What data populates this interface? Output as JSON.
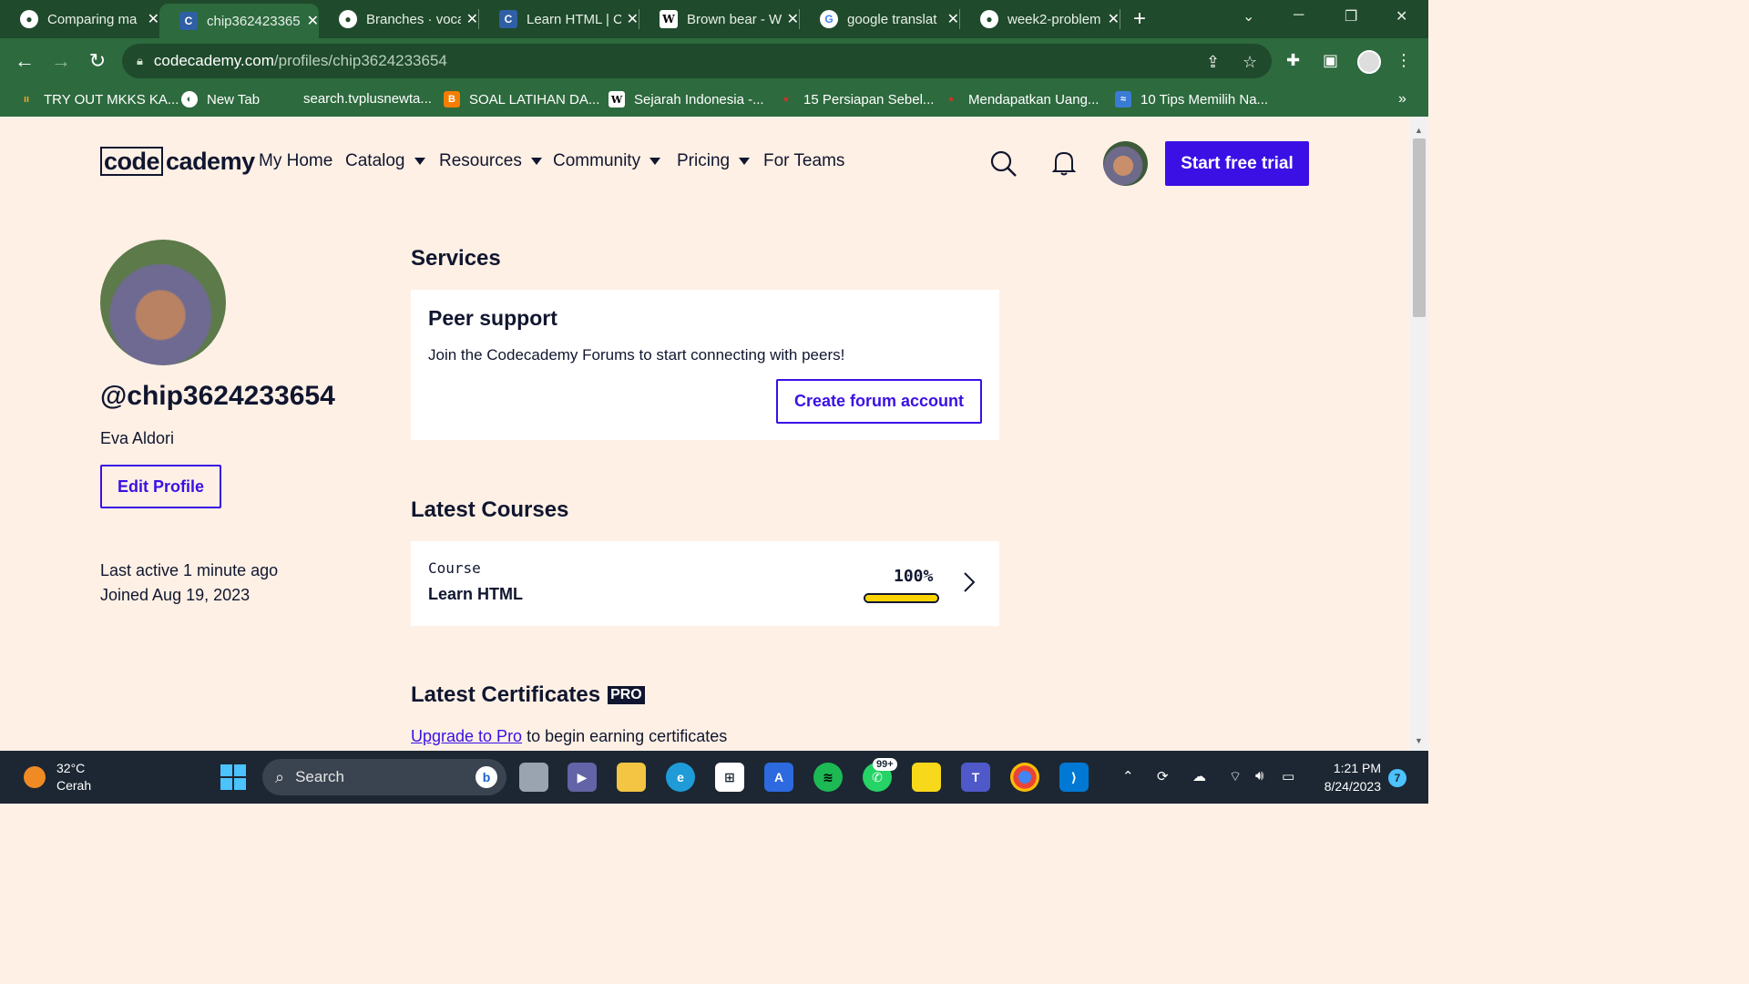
{
  "tabs": [
    {
      "label": "Comparing ma",
      "icon": "github-icon",
      "active": false
    },
    {
      "label": "chip362423365",
      "icon": "codecademy-icon",
      "active": true
    },
    {
      "label": "Branches · voca",
      "icon": "github-icon",
      "active": false
    },
    {
      "label": "Learn HTML | C",
      "icon": "codecademy-icon",
      "active": false
    },
    {
      "label": "Brown bear - W",
      "icon": "wikipedia-icon",
      "active": false
    },
    {
      "label": "google translat",
      "icon": "google-icon",
      "active": false
    },
    {
      "label": "week2-problem",
      "icon": "github-icon",
      "active": false
    }
  ],
  "address": {
    "host": "codecademy.com",
    "path": "/profiles/chip3624233654"
  },
  "bookmarks": [
    {
      "label": "TRY OUT MKKS KA...",
      "icon": "bookmark-favicon"
    },
    {
      "label": "New Tab",
      "icon": "chrome-icon"
    },
    {
      "label": "search.tvplusnewta...",
      "icon": ""
    },
    {
      "label": "SOAL LATIHAN DA...",
      "icon": "blogger-icon"
    },
    {
      "label": "Sejarah Indonesia -...",
      "icon": "wikipedia-icon"
    },
    {
      "label": "15 Persiapan Sebel...",
      "icon": "pin-icon"
    },
    {
      "label": "Mendapatkan Uang...",
      "icon": "pin-icon"
    },
    {
      "label": "10 Tips Memilih Na...",
      "icon": "site-icon"
    }
  ],
  "site": {
    "logo_left": "code",
    "logo_right": "cademy",
    "nav": [
      {
        "label": "My Home",
        "dropdown": false
      },
      {
        "label": "Catalog",
        "dropdown": true
      },
      {
        "label": "Resources",
        "dropdown": true
      },
      {
        "label": "Community",
        "dropdown": true
      },
      {
        "label": "Pricing",
        "dropdown": true
      },
      {
        "label": "For Teams",
        "dropdown": false
      }
    ],
    "cta": "Start free trial",
    "accent": "#3a10e5"
  },
  "profile": {
    "handle": "@chip3624233654",
    "name": "Eva Aldori",
    "edit_label": "Edit Profile",
    "last_active": "Last active 1 minute ago",
    "joined": "Joined Aug 19, 2023"
  },
  "services": {
    "title": "Services",
    "peer_title": "Peer support",
    "peer_desc": "Join the Codecademy Forums to start connecting with peers!",
    "button": "Create forum account"
  },
  "courses": {
    "title": "Latest Courses",
    "items": [
      {
        "kind": "Course",
        "name": "Learn HTML",
        "percent_label": "100%",
        "progress": 1.0
      }
    ]
  },
  "certificates": {
    "title": "Latest Certificates",
    "badge": "PRO",
    "link": "Upgrade to Pro",
    "rest": " to begin earning certificates"
  },
  "taskbar": {
    "temp": "32°C",
    "condition": "Cerah",
    "search": "Search",
    "whatsapp_badge": "99+",
    "time": "1:21 PM",
    "date": "8/24/2023",
    "notifications": "7"
  }
}
